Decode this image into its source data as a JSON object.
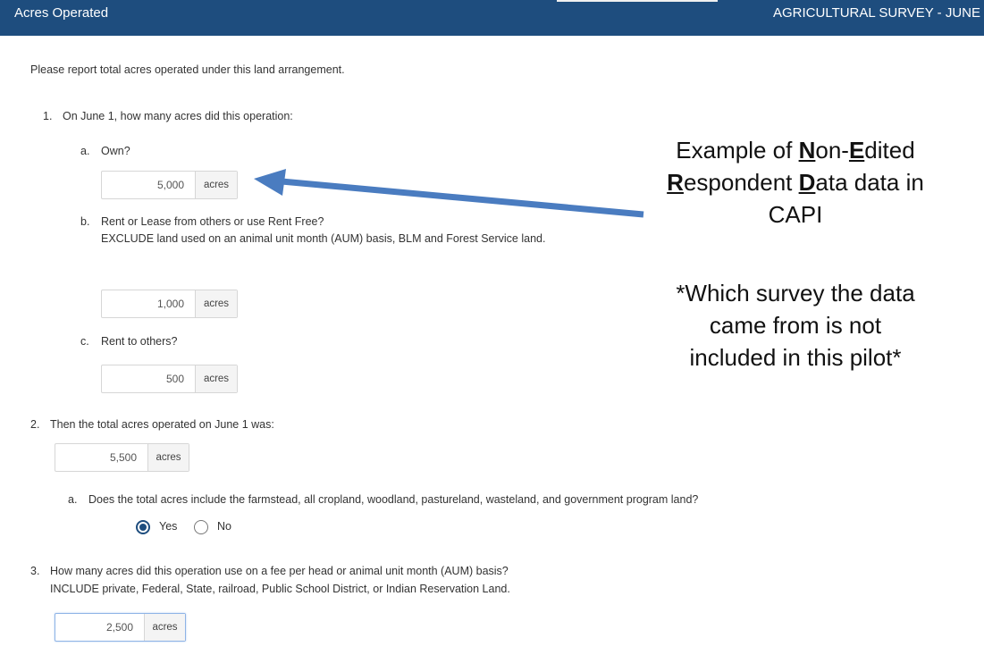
{
  "header": {
    "title": "Acres Operated",
    "survey": "AGRICULTURAL SURVEY - JUNE"
  },
  "intro": "Please report total acres operated under this land arrangement.",
  "q1": {
    "num": "1.",
    "text": "On June 1, how many acres did this operation:",
    "a": {
      "letter": "a.",
      "text": "Own?",
      "value": "5,000",
      "unit": "acres"
    },
    "b": {
      "letter": "b.",
      "text": "Rent or Lease from others or use Rent Free?",
      "text2": "EXCLUDE land used on an animal unit month (AUM) basis, BLM and Forest Service land.",
      "value": "1,000",
      "unit": "acres"
    },
    "c": {
      "letter": "c.",
      "text": "Rent to others?",
      "value": "500",
      "unit": "acres"
    }
  },
  "q2": {
    "num": "2.",
    "text": "Then the total acres operated on June 1 was:",
    "value": "5,500",
    "unit": "acres",
    "a": {
      "letter": "a.",
      "text": "Does the total acres include the farmstead, all cropland, woodland, pastureland, wasteland, and government program land?",
      "yes": "Yes",
      "no": "No",
      "selected": "Yes"
    }
  },
  "q3": {
    "num": "3.",
    "text": "How many acres did this operation use on a fee per head or animal unit month (AUM) basis?",
    "text2": "INCLUDE private, Federal, State, railroad, Public School District, or Indian Reservation Land.",
    "value": "2,500",
    "unit": "acres"
  },
  "annotation": {
    "l1_pre": "Example of ",
    "l1_b1": "N",
    "l1_mid": "on-",
    "l1_b2": "E",
    "l1_post": "dited",
    "l2_b1": "R",
    "l2_mid": "espondent ",
    "l2_b2": "D",
    "l2_post": "ata data in",
    "l3": "CAPI",
    "note1": "*Which survey the data",
    "note2": "came from is not",
    "note3": "included in this pilot*"
  },
  "colors": {
    "header": "#1e4d7e",
    "arrow": "#4a7cc0"
  }
}
